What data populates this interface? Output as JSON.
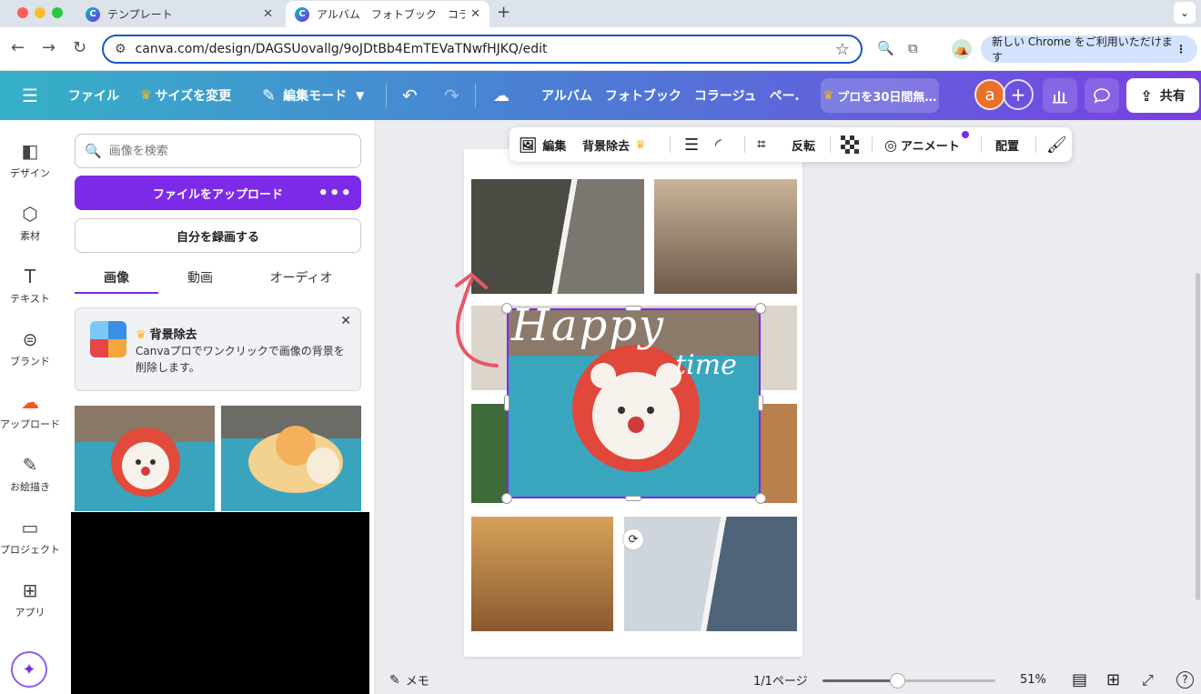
{
  "browser": {
    "tabs": [
      {
        "title": "テンプレート",
        "favicon": "C"
      },
      {
        "title": "アルバム　フォトブック　コラー",
        "favicon": "C"
      }
    ],
    "url": "canva.com/design/DAGSUovallg/9oJDtBb4EmTEVaTNwfHJKQ/edit",
    "banner": "新しい Chrome をご利用いただけます",
    "traffic_colors": [
      "#ff5f57",
      "#febc2e",
      "#28c840"
    ]
  },
  "topbar": {
    "file": "ファイル",
    "resize": "サイズを変更",
    "edit_mode": "編集モード",
    "doc_title": "アルバム　フォトブック　コラージュ　ペー…",
    "pro": "プロを30日間無…",
    "avatar": "a",
    "share": "共有"
  },
  "rail": [
    {
      "label": "デザイン",
      "icon": "design-icon"
    },
    {
      "label": "素材",
      "icon": "elements-icon"
    },
    {
      "label": "テキスト",
      "icon": "text-icon"
    },
    {
      "label": "ブランド",
      "icon": "brand-icon"
    },
    {
      "label": "アップロード",
      "icon": "upload-icon"
    },
    {
      "label": "お絵描き",
      "icon": "draw-icon"
    },
    {
      "label": "プロジェクト",
      "icon": "folder-icon"
    },
    {
      "label": "アプリ",
      "icon": "apps-icon"
    }
  ],
  "panel": {
    "search_placeholder": "画像を検索",
    "upload": "ファイルをアップロード",
    "record": "自分を録画する",
    "tabs": [
      "画像",
      "動画",
      "オーディオ"
    ],
    "promo": {
      "title": "背景除去",
      "text": "Canvaプロでワンクリックで画像の背景を削除します。"
    }
  },
  "toolbar": {
    "edit": "編集",
    "bg_remove": "背景除去",
    "flip": "反転",
    "animate": "アニメート",
    "position": "配置"
  },
  "canvas": {
    "happy": "Happy",
    "time": "time"
  },
  "status": {
    "memo": "メモ",
    "page": "1/1ページ",
    "zoom_text": "51%",
    "zoom_level": 0.43,
    "help": "?"
  },
  "colors": {
    "accent": "#7d2ae8",
    "selection": "#7d2ae8"
  }
}
